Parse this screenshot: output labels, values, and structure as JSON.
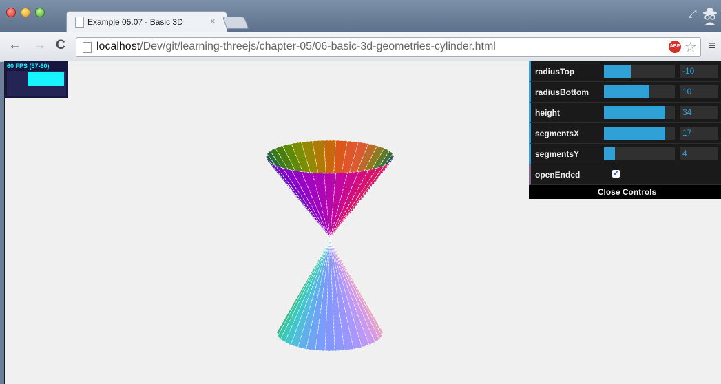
{
  "browser": {
    "tab_title": "Example 05.07 - Basic 3D",
    "tab_close": "×",
    "url_host": "localhost",
    "url_path": "/Dev/git/learning-threejs/chapter-05/06-basic-3d-geometries-cylinder.html",
    "abp_label": "ABP",
    "back_icon": "←",
    "forward_icon": "→",
    "reload_icon": "C",
    "star_icon": "☆",
    "menu_icon": "≡",
    "fullscreen_icon": "⤢"
  },
  "stats": {
    "fps_text": "60 FPS (57-60)"
  },
  "gui": {
    "controls": [
      {
        "label": "radiusTop",
        "value": "-10",
        "fill": 0.38
      },
      {
        "label": "radiusBottom",
        "value": "10",
        "fill": 0.64
      },
      {
        "label": "height",
        "value": "34",
        "fill": 0.86
      },
      {
        "label": "segmentsX",
        "value": "17",
        "fill": 0.86
      },
      {
        "label": "segmentsY",
        "value": "4",
        "fill": 0.16
      }
    ],
    "opened_label": "openEnded",
    "opened_checked": true,
    "close_label": "Close Controls"
  },
  "colors": {
    "gui_accent": "#2fa1d6",
    "stats_accent": "#18f4ff",
    "page_background": "#f0f0f0"
  }
}
